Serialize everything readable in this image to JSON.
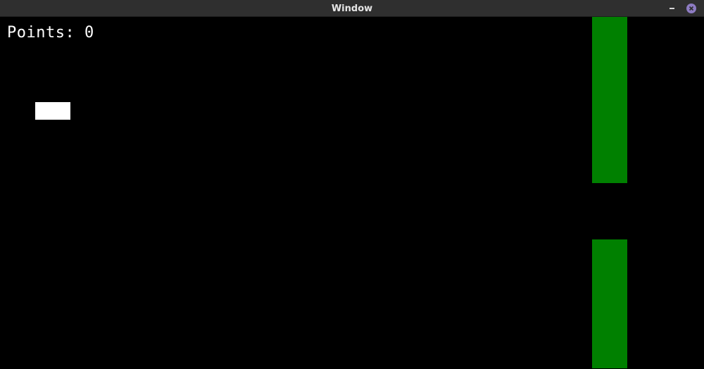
{
  "window": {
    "title": "Window"
  },
  "hud": {
    "score_label": "Points:",
    "score_value": "0"
  },
  "colors": {
    "background": "#000000",
    "titlebar": "#2f2f2f",
    "pipe": "#008000",
    "player": "#ffffff",
    "close_button": "#8e7cc3",
    "text": "#ffffff"
  },
  "icons": {
    "minimize": "minimize-icon",
    "close": "close-icon"
  }
}
